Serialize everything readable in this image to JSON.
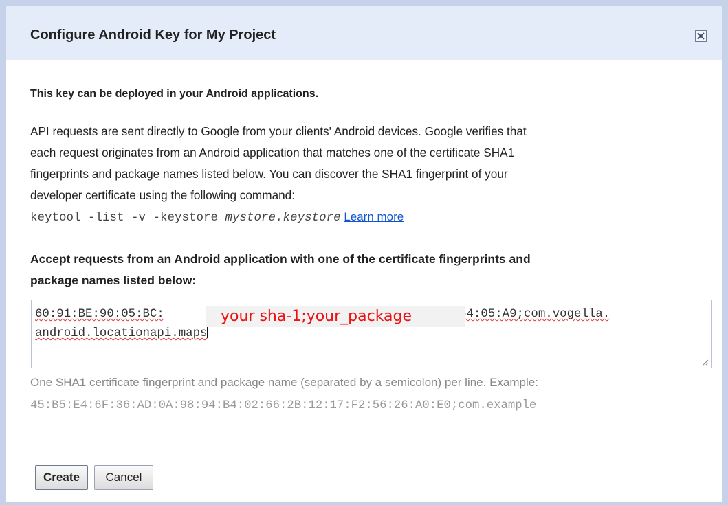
{
  "dialog": {
    "title": "Configure Android Key for My Project",
    "close_icon": "close-icon"
  },
  "content": {
    "heading": "This key can be deployed in your Android applications.",
    "paragraph_lines": [
      "API requests are sent directly to Google from your clients' Android devices. Google verifies that",
      "each request originates from an Android application that matches one of the certificate SHA1",
      "fingerprints and package names listed below. You can discover the SHA1 fingerprint of your",
      "developer certificate using the following command:"
    ],
    "command": {
      "prefix": "keytool -list -v -keystore ",
      "store": "mystore.keystore",
      "learn_more": "Learn more"
    },
    "accept_heading_lines": [
      "Accept requests from an Android application with one of the certificate fingerprints and",
      "package names listed below:"
    ]
  },
  "textarea": {
    "line1_start": "60:91:BE:90:05:BC:",
    "line1_end": "3:49:64:05:A9;",
    "line1_pkg": "com.vogella.",
    "line2": "android.locationapi.maps",
    "overlay": "your sha-1;your_package"
  },
  "help": {
    "text": "One SHA1 certificate fingerprint and package name (separated by a semicolon) per line. Example:",
    "example": "45:B5:E4:6F:36:AD:0A:98:94:B4:02:66:2B:12:17:F2:56:26:A0:E0;com.example"
  },
  "buttons": {
    "create": "Create",
    "cancel": "Cancel"
  }
}
